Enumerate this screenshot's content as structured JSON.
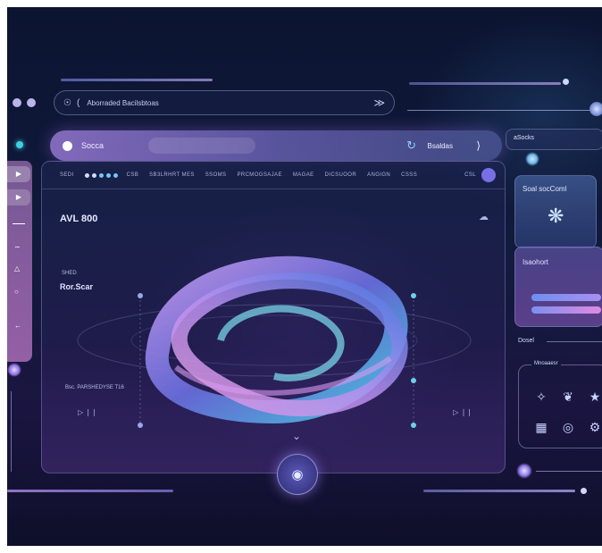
{
  "browser": {
    "url_text": "Aborraded Bacilsbtoas",
    "back_glyph": "(",
    "forward_glyph": "≫"
  },
  "search": {
    "label": "Socca",
    "button_label": "Bsaldas",
    "arrow_glyph": "⟩"
  },
  "toolbar": {
    "first": "SEDI",
    "items": [
      "CSB",
      "SB3LRHRT MES",
      "SSOMS",
      "PRCMOGSAJAE",
      "MAGAE",
      "DICSUOOR",
      "ANGIGN",
      "CSSS"
    ],
    "right_label": "CSL"
  },
  "main": {
    "title": "AVL 800",
    "caption_small": "SHED",
    "caption": "Ror.Scar",
    "lower_label": "Bsc. PARSHEDYSE T16",
    "left_play": "▷ ❘❘",
    "right_play": "▷ ❘❘",
    "chevron": "⌄"
  },
  "right_panel": {
    "header": "aSocks",
    "card_title": "Soal socComl",
    "card_subtitle": "Isaohort",
    "section_label": "Dosel",
    "group_label": "Mnoaaesr"
  },
  "colors": {
    "accent_purple": "#9b7de0",
    "accent_cyan": "#3fd0e0",
    "accent_pink": "#e48ad8",
    "background": "#0e1634"
  },
  "icons": [
    "molecule-icon",
    "circuit-icon",
    "leaf-icon",
    "bookmark-icon",
    "shield-icon",
    "grid-icon",
    "vr-headset-icon",
    "gear-icon"
  ]
}
